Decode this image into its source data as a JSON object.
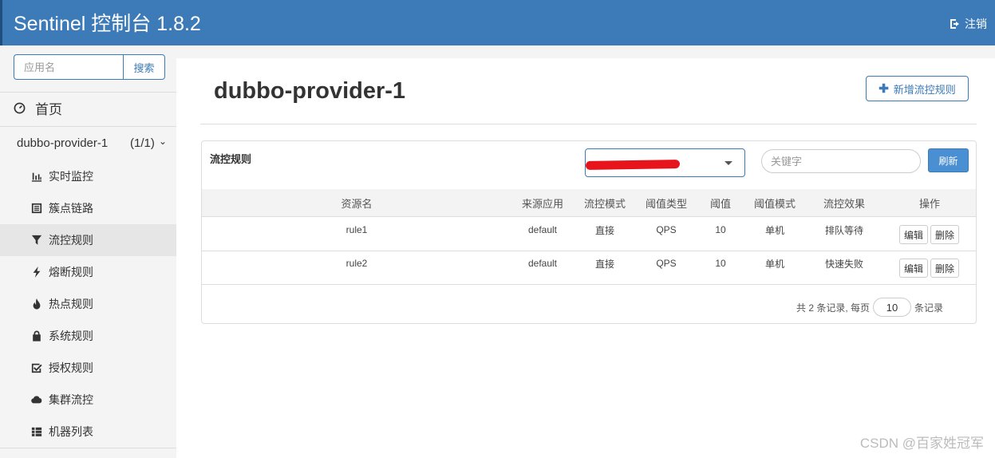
{
  "header": {
    "brand": "Sentinel 控制台 1.8.2",
    "logout_label": "注销"
  },
  "sidebar": {
    "search_placeholder": "应用名",
    "search_button": "搜索",
    "home_label": "首页",
    "app": {
      "name": "dubbo-provider-1",
      "count": "(1/1)"
    },
    "items": [
      {
        "label": "实时监控",
        "icon": "bar-chart-icon",
        "active": false
      },
      {
        "label": "簇点链路",
        "icon": "list-icon",
        "active": false
      },
      {
        "label": "流控规则",
        "icon": "filter-icon",
        "active": true
      },
      {
        "label": "熔断规则",
        "icon": "flash-icon",
        "active": false
      },
      {
        "label": "热点规则",
        "icon": "fire-icon",
        "active": false
      },
      {
        "label": "系统规则",
        "icon": "lock-icon",
        "active": false
      },
      {
        "label": "授权规则",
        "icon": "check-square-icon",
        "active": false
      },
      {
        "label": "集群流控",
        "icon": "cloud-icon",
        "active": false
      },
      {
        "label": "机器列表",
        "icon": "th-list-icon",
        "active": false
      }
    ]
  },
  "main": {
    "title": "dubbo-provider-1",
    "add_button": "新增流控规则",
    "panel_title": "流控规则",
    "keyword_placeholder": "关键字",
    "refresh_button": "刷新",
    "columns": [
      "资源名",
      "来源应用",
      "流控模式",
      "阈值类型",
      "阈值",
      "阈值模式",
      "流控效果",
      "操作"
    ],
    "rows": [
      {
        "resource": "rule1",
        "origin": "default",
        "mode": "直接",
        "grade": "QPS",
        "threshold": "10",
        "cluster_mode": "单机",
        "effect": "排队等待"
      },
      {
        "resource": "rule2",
        "origin": "default",
        "mode": "直接",
        "grade": "QPS",
        "threshold": "10",
        "cluster_mode": "单机",
        "effect": "快速失败"
      }
    ],
    "edit_button": "编辑",
    "delete_button": "删除",
    "pager": {
      "prefix": "共 2 条记录, 每页",
      "page_size": "10",
      "suffix": "条记录"
    }
  },
  "watermark": "CSDN @百家姓冠军"
}
